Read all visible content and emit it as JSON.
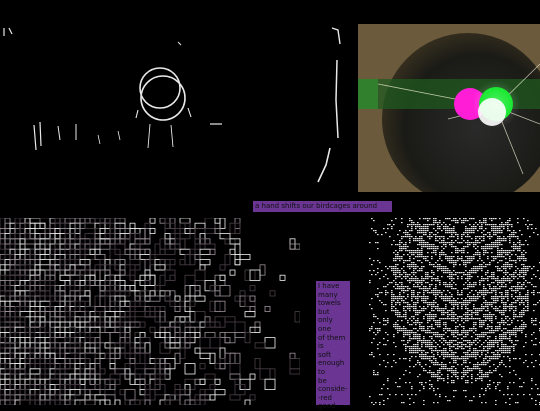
{
  "captions": {
    "top": "a hand shifts our birdcages around",
    "side_lines": [
      "I have",
      "many",
      "towels",
      "but",
      "only",
      "one",
      "of them",
      "is",
      "soft",
      "enough",
      "to",
      "be",
      "conside-",
      "-red",
      "good"
    ]
  },
  "colors": {
    "caption_bg": "#6a3593",
    "lens_bg": "#6b5a3c",
    "magenta": "#ff1dd6",
    "green": "#00e61a"
  }
}
